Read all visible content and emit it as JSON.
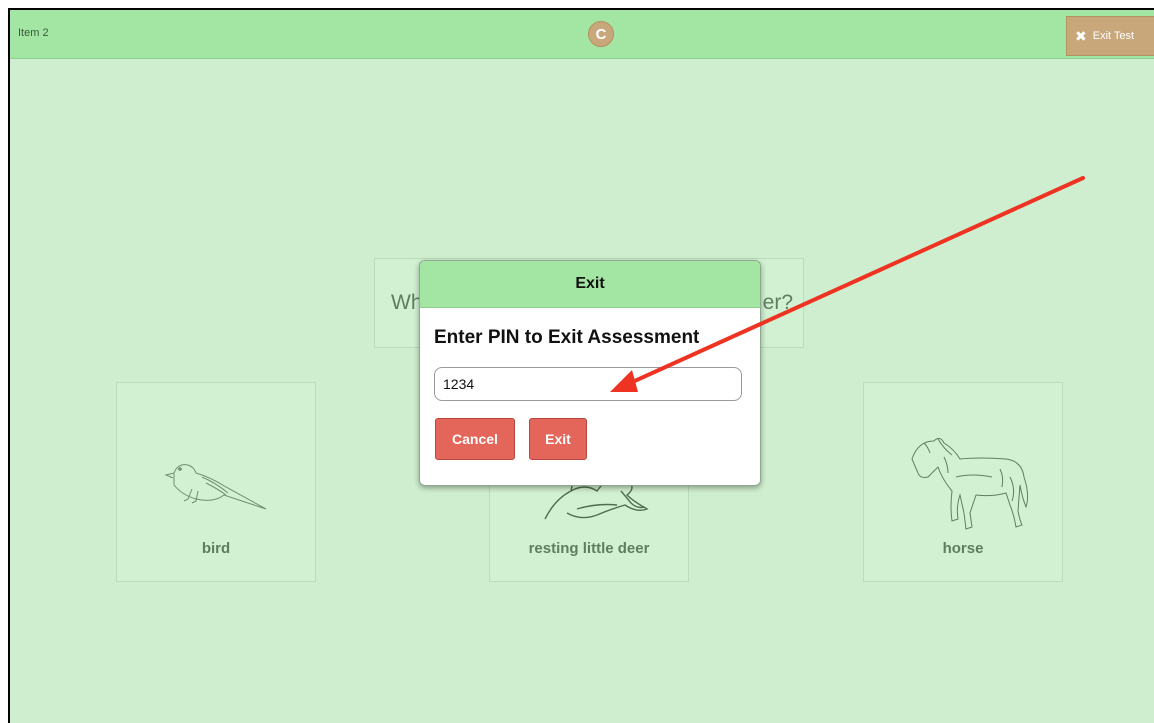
{
  "header": {
    "item_label": "Item 2",
    "refresh_icon_glyph": "C",
    "exit_test_label": "Exit Test",
    "exit_test_icon_glyph": "✖"
  },
  "question": {
    "visible_left": "Wh",
    "visible_right": "er?"
  },
  "choices": [
    {
      "label": "bird",
      "icon": "bird-drawing"
    },
    {
      "label": "resting little deer",
      "icon": "deer-drawing"
    },
    {
      "label": "horse",
      "icon": "horse-drawing"
    }
  ],
  "modal": {
    "header": "Exit",
    "title": "Enter PIN to Exit Assessment",
    "pin_value": "1234",
    "cancel_label": "Cancel",
    "exit_label": "Exit"
  },
  "colors": {
    "background": "#cfeecf",
    "topbar": "#a3e6a3",
    "accent_button": "#e4655a",
    "header_button": "#c8a77a",
    "annotation_arrow": "#ee3322"
  }
}
